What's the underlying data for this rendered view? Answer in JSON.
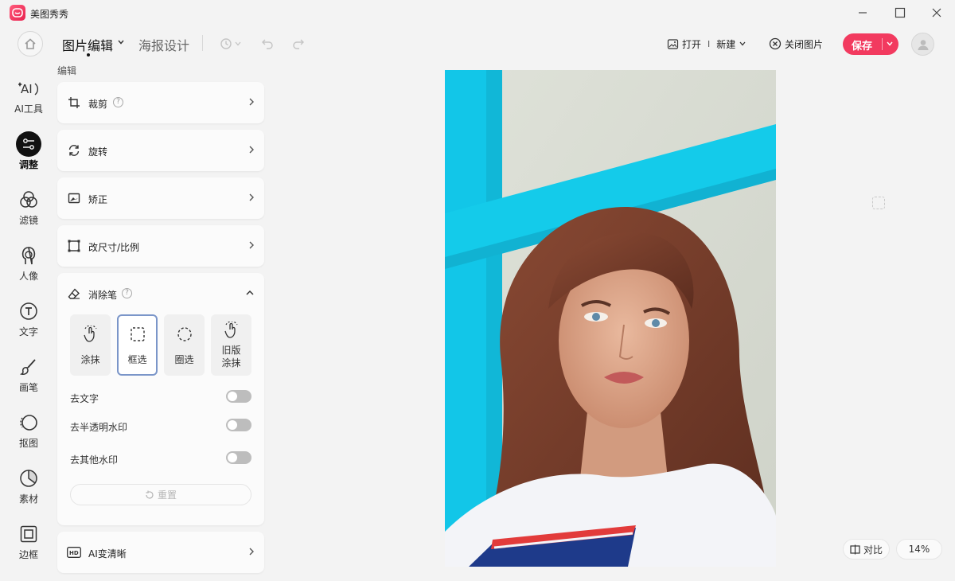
{
  "app": {
    "name": "美图秀秀"
  },
  "toolbar": {
    "tab_edit": "图片编辑",
    "tab_poster": "海报设计",
    "open_label": "打开",
    "separator": "I",
    "new_label": "新建",
    "close_image_label": "关闭图片",
    "save_label": "保存"
  },
  "nav": [
    {
      "label": "AI工具",
      "icon": "ai-tools-icon"
    },
    {
      "label": "调整",
      "icon": "adjust-icon",
      "active": true
    },
    {
      "label": "滤镜",
      "icon": "filter-icon"
    },
    {
      "label": "人像",
      "icon": "portrait-icon"
    },
    {
      "label": "文字",
      "icon": "text-icon"
    },
    {
      "label": "画笔",
      "icon": "brush-icon"
    },
    {
      "label": "抠图",
      "icon": "cutout-icon"
    },
    {
      "label": "素材",
      "icon": "material-icon"
    },
    {
      "label": "边框",
      "icon": "frame-icon"
    }
  ],
  "panel": {
    "section_label": "编辑",
    "crop": "裁剪",
    "rotate": "旋转",
    "correct": "矫正",
    "resize": "改尺寸/比例",
    "eraser": {
      "title": "消除笔",
      "tools": [
        {
          "label": "涂抹"
        },
        {
          "label": "框选",
          "selected": true
        },
        {
          "label": "圈选"
        },
        {
          "label": "旧版涂抹",
          "line1": "旧版",
          "line2": "涂抹"
        }
      ],
      "toggles": [
        {
          "label": "去文字",
          "on": false
        },
        {
          "label": "去半透明水印",
          "on": false
        },
        {
          "label": "去其他水印",
          "on": false
        }
      ],
      "reset_label": "重置"
    },
    "ai_sharpen": "AI变清晰"
  },
  "canvas": {
    "compare_label": "对比",
    "zoom": "14%",
    "colors": {
      "accent": "#f23a5f",
      "frame_blue": "#13c8e8",
      "wall": "#d9ddd3"
    }
  }
}
